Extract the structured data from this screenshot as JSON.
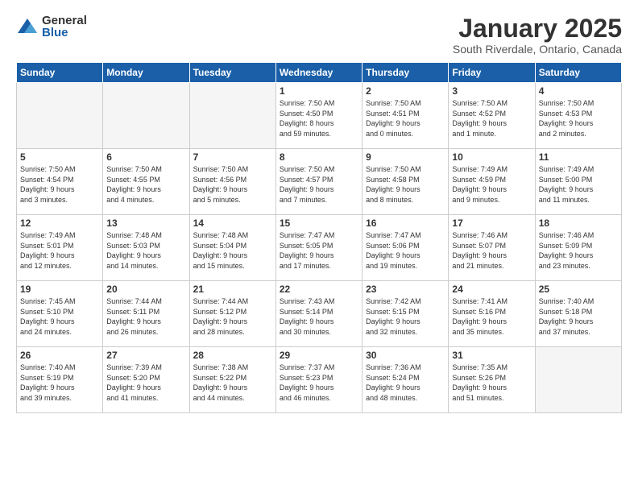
{
  "logo": {
    "general": "General",
    "blue": "Blue"
  },
  "title": "January 2025",
  "subtitle": "South Riverdale, Ontario, Canada",
  "days_of_week": [
    "Sunday",
    "Monday",
    "Tuesday",
    "Wednesday",
    "Thursday",
    "Friday",
    "Saturday"
  ],
  "weeks": [
    [
      {
        "day": "",
        "info": ""
      },
      {
        "day": "",
        "info": ""
      },
      {
        "day": "",
        "info": ""
      },
      {
        "day": "1",
        "info": "Sunrise: 7:50 AM\nSunset: 4:50 PM\nDaylight: 8 hours\nand 59 minutes."
      },
      {
        "day": "2",
        "info": "Sunrise: 7:50 AM\nSunset: 4:51 PM\nDaylight: 9 hours\nand 0 minutes."
      },
      {
        "day": "3",
        "info": "Sunrise: 7:50 AM\nSunset: 4:52 PM\nDaylight: 9 hours\nand 1 minute."
      },
      {
        "day": "4",
        "info": "Sunrise: 7:50 AM\nSunset: 4:53 PM\nDaylight: 9 hours\nand 2 minutes."
      }
    ],
    [
      {
        "day": "5",
        "info": "Sunrise: 7:50 AM\nSunset: 4:54 PM\nDaylight: 9 hours\nand 3 minutes."
      },
      {
        "day": "6",
        "info": "Sunrise: 7:50 AM\nSunset: 4:55 PM\nDaylight: 9 hours\nand 4 minutes."
      },
      {
        "day": "7",
        "info": "Sunrise: 7:50 AM\nSunset: 4:56 PM\nDaylight: 9 hours\nand 5 minutes."
      },
      {
        "day": "8",
        "info": "Sunrise: 7:50 AM\nSunset: 4:57 PM\nDaylight: 9 hours\nand 7 minutes."
      },
      {
        "day": "9",
        "info": "Sunrise: 7:50 AM\nSunset: 4:58 PM\nDaylight: 9 hours\nand 8 minutes."
      },
      {
        "day": "10",
        "info": "Sunrise: 7:49 AM\nSunset: 4:59 PM\nDaylight: 9 hours\nand 9 minutes."
      },
      {
        "day": "11",
        "info": "Sunrise: 7:49 AM\nSunset: 5:00 PM\nDaylight: 9 hours\nand 11 minutes."
      }
    ],
    [
      {
        "day": "12",
        "info": "Sunrise: 7:49 AM\nSunset: 5:01 PM\nDaylight: 9 hours\nand 12 minutes."
      },
      {
        "day": "13",
        "info": "Sunrise: 7:48 AM\nSunset: 5:03 PM\nDaylight: 9 hours\nand 14 minutes."
      },
      {
        "day": "14",
        "info": "Sunrise: 7:48 AM\nSunset: 5:04 PM\nDaylight: 9 hours\nand 15 minutes."
      },
      {
        "day": "15",
        "info": "Sunrise: 7:47 AM\nSunset: 5:05 PM\nDaylight: 9 hours\nand 17 minutes."
      },
      {
        "day": "16",
        "info": "Sunrise: 7:47 AM\nSunset: 5:06 PM\nDaylight: 9 hours\nand 19 minutes."
      },
      {
        "day": "17",
        "info": "Sunrise: 7:46 AM\nSunset: 5:07 PM\nDaylight: 9 hours\nand 21 minutes."
      },
      {
        "day": "18",
        "info": "Sunrise: 7:46 AM\nSunset: 5:09 PM\nDaylight: 9 hours\nand 23 minutes."
      }
    ],
    [
      {
        "day": "19",
        "info": "Sunrise: 7:45 AM\nSunset: 5:10 PM\nDaylight: 9 hours\nand 24 minutes."
      },
      {
        "day": "20",
        "info": "Sunrise: 7:44 AM\nSunset: 5:11 PM\nDaylight: 9 hours\nand 26 minutes."
      },
      {
        "day": "21",
        "info": "Sunrise: 7:44 AM\nSunset: 5:12 PM\nDaylight: 9 hours\nand 28 minutes."
      },
      {
        "day": "22",
        "info": "Sunrise: 7:43 AM\nSunset: 5:14 PM\nDaylight: 9 hours\nand 30 minutes."
      },
      {
        "day": "23",
        "info": "Sunrise: 7:42 AM\nSunset: 5:15 PM\nDaylight: 9 hours\nand 32 minutes."
      },
      {
        "day": "24",
        "info": "Sunrise: 7:41 AM\nSunset: 5:16 PM\nDaylight: 9 hours\nand 35 minutes."
      },
      {
        "day": "25",
        "info": "Sunrise: 7:40 AM\nSunset: 5:18 PM\nDaylight: 9 hours\nand 37 minutes."
      }
    ],
    [
      {
        "day": "26",
        "info": "Sunrise: 7:40 AM\nSunset: 5:19 PM\nDaylight: 9 hours\nand 39 minutes."
      },
      {
        "day": "27",
        "info": "Sunrise: 7:39 AM\nSunset: 5:20 PM\nDaylight: 9 hours\nand 41 minutes."
      },
      {
        "day": "28",
        "info": "Sunrise: 7:38 AM\nSunset: 5:22 PM\nDaylight: 9 hours\nand 44 minutes."
      },
      {
        "day": "29",
        "info": "Sunrise: 7:37 AM\nSunset: 5:23 PM\nDaylight: 9 hours\nand 46 minutes."
      },
      {
        "day": "30",
        "info": "Sunrise: 7:36 AM\nSunset: 5:24 PM\nDaylight: 9 hours\nand 48 minutes."
      },
      {
        "day": "31",
        "info": "Sunrise: 7:35 AM\nSunset: 5:26 PM\nDaylight: 9 hours\nand 51 minutes."
      },
      {
        "day": "",
        "info": ""
      }
    ]
  ]
}
